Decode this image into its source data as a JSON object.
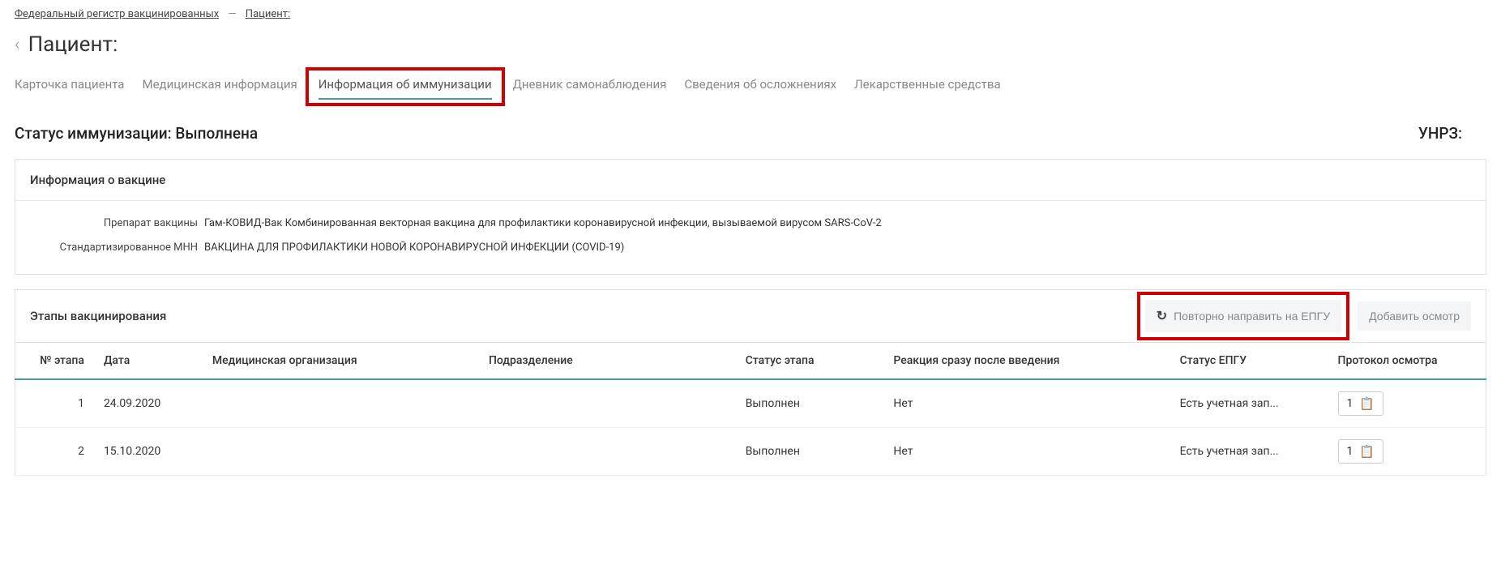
{
  "breadcrumb": {
    "root": "Федеральный регистр вакцинированных",
    "current": "Пациент:"
  },
  "pageTitle": "Пациент:",
  "tabs": [
    {
      "label": "Карточка пациента",
      "active": false
    },
    {
      "label": "Медицинская информация",
      "active": false
    },
    {
      "label": "Информация об иммунизации",
      "active": true,
      "highlighted": true
    },
    {
      "label": "Дневник самонаблюдения",
      "active": false
    },
    {
      "label": "Сведения об осложнениях",
      "active": false
    },
    {
      "label": "Лекарственные средства",
      "active": false
    }
  ],
  "status": {
    "label": "Статус иммунизации: Выполнена",
    "unrz": "УНРЗ:"
  },
  "vaccineInfo": {
    "title": "Информация о вакцине",
    "preparation": {
      "label": "Препарат вакцины",
      "value": "Гам-КОВИД-Вак Комбинированная векторная вакцина для профилактики коронавирусной инфекции, вызываемой вирусом SARS-CoV-2"
    },
    "mnn": {
      "label": "Стандартизированное МНН",
      "value": "ВАКЦИНА ДЛЯ ПРОФИЛАКТИКИ НОВОЙ КОРОНАВИРУСНОЙ ИНФЕКЦИИ (COVID-19)"
    }
  },
  "stages": {
    "title": "Этапы вакцинирования",
    "buttons": {
      "resend": "Повторно направить на ЕПГУ",
      "addExam": "Добавить осмотр"
    },
    "columns": {
      "stage": "№ этапа",
      "date": "Дата",
      "medorg": "Медицинская организация",
      "division": "Подразделение",
      "status": "Статус этапа",
      "reaction": "Реакция сразу после введения",
      "epgu": "Статус ЕПГУ",
      "protocol": "Протокол осмотра"
    },
    "rows": [
      {
        "stage": "1",
        "date": "24.09.2020",
        "medorg": "",
        "division": "",
        "status": "Выполнен",
        "reaction": "Нет",
        "epgu": "Есть учетная зап...",
        "protocol": "1"
      },
      {
        "stage": "2",
        "date": "15.10.2020",
        "medorg": "",
        "division": "",
        "status": "Выполнен",
        "reaction": "Нет",
        "epgu": "Есть учетная зап...",
        "protocol": "1"
      }
    ]
  }
}
